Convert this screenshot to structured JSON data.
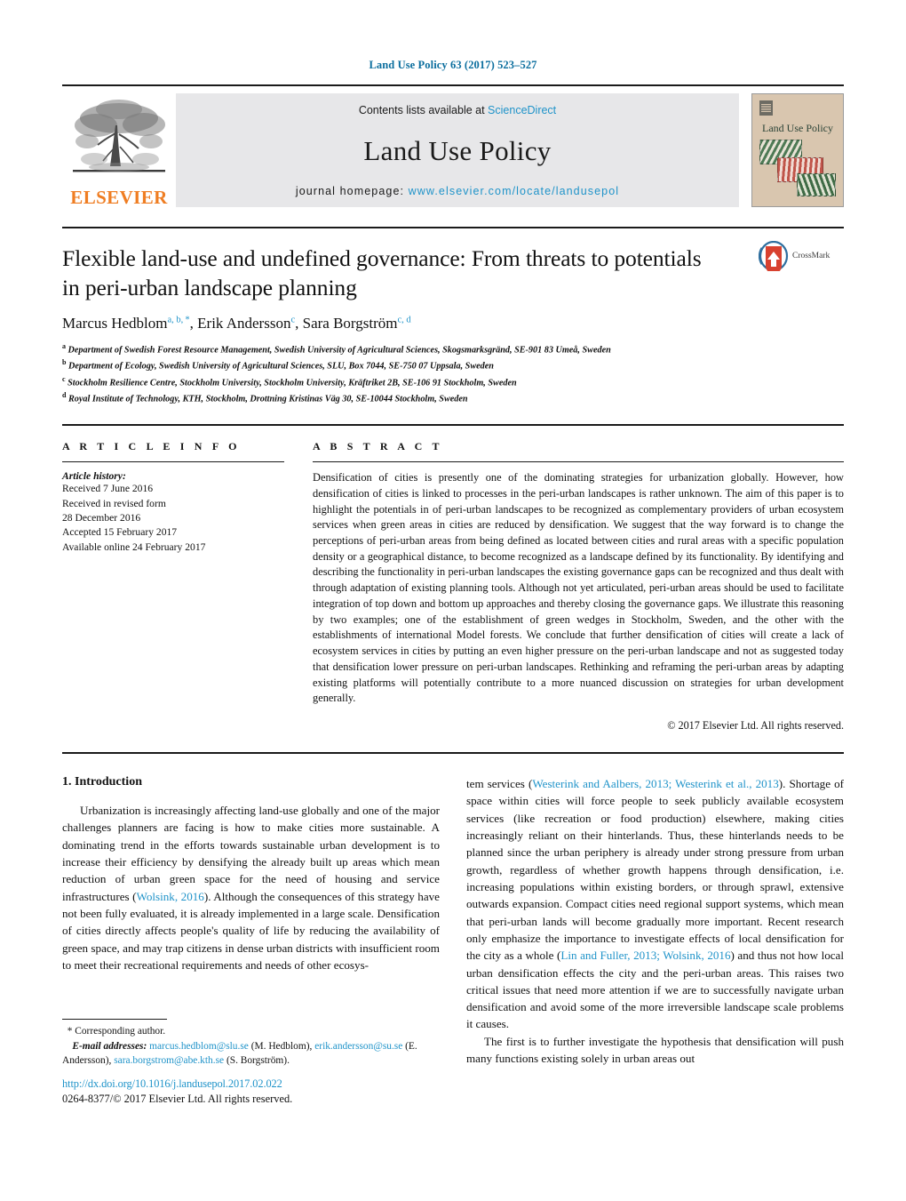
{
  "running_head": "Land Use Policy 63 (2017) 523–527",
  "masthead": {
    "publisher_name": "ELSEVIER",
    "contents_prefix": "Contents lists available at ",
    "contents_link": "ScienceDirect",
    "journal_name": "Land Use Policy",
    "homepage_prefix": "journal homepage: ",
    "homepage_url": "www.elsevier.com/locate/landusepol",
    "cover_title": "Land Use Policy"
  },
  "article": {
    "title": "Flexible land-use and undefined governance: From threats to potentials in peri-urban landscape planning",
    "crossmark_label": "CrossMark",
    "authors_html": "Marcus Hedblom<sup>a, b, *</sup>, Erik Andersson<sup>c</sup>, Sara Borgström<sup>c, d</sup>",
    "affiliations": [
      {
        "marker": "a",
        "text": "Department of Swedish Forest Resource Management, Swedish University of Agricultural Sciences, Skogsmarksgränd, SE-901 83 Umeå, Sweden"
      },
      {
        "marker": "b",
        "text": "Department of Ecology, Swedish University of Agricultural Sciences, SLU, Box 7044, SE-750 07 Uppsala, Sweden"
      },
      {
        "marker": "c",
        "text": "Stockholm Resilience Centre, Stockholm University, Stockholm University, Kräftriket 2B, SE-106 91 Stockholm, Sweden"
      },
      {
        "marker": "d",
        "text": "Royal Institute of Technology, KTH, Stockholm, Drottning Kristinas Väg 30, SE-10044 Stockholm, Sweden"
      }
    ]
  },
  "article_info": {
    "heading": "A R T I C L E   I N F O",
    "history_label": "Article history:",
    "history_lines": [
      "Received 7 June 2016",
      "Received in revised form",
      "28 December 2016",
      "Accepted 15 February 2017",
      "Available online 24 February 2017"
    ]
  },
  "abstract": {
    "heading": "A B S T R A C T",
    "text": "Densification of cities is presently one of the dominating strategies for urbanization globally. However, how densification of cities is linked to processes in the peri-urban landscapes is rather unknown. The aim of this paper is to highlight the potentials in of peri-urban landscapes to be recognized as complementary providers of urban ecosystem services when green areas in cities are reduced by densification. We suggest that the way forward is to change the perceptions of peri-urban areas from being defined as located between cities and rural areas with a specific population density or a geographical distance, to become recognized as a landscape defined by its functionality. By identifying and describing the functionality in peri-urban landscapes the existing governance gaps can be recognized and thus dealt with through adaptation of existing planning tools. Although not yet articulated, peri-urban areas should be used to facilitate integration of top down and bottom up approaches and thereby closing the governance gaps. We illustrate this reasoning by two examples; one of the establishment of green wedges in Stockholm, Sweden, and the other with the establishments of international Model forests. We conclude that further densification of cities will create a lack of ecosystem services in cities by putting an even higher pressure on the peri-urban landscape and not as suggested today that densification lower pressure on peri-urban landscapes. Rethinking and reframing the peri-urban areas by adapting existing platforms will potentially contribute to a more nuanced discussion on strategies for urban development generally.",
    "copyright": "© 2017 Elsevier Ltd. All rights reserved."
  },
  "body": {
    "section_heading": "1.  Introduction",
    "left_paragraph_1_a": "Urbanization is increasingly affecting land-use globally and one of the major challenges planners are facing is how to make cities more sustainable. A dominating trend in the efforts towards sustainable urban development is to increase their efficiency by densifying the already built up areas which mean reduction of urban green space for the need of housing and service infrastructures (",
    "cite_wolsink_2016": "Wolsink, 2016",
    "left_paragraph_1_b": "). Although the consequences of this strategy have not been fully evaluated, it is already implemented in a large scale. Densification of cities directly affects people's quality of life by reducing the availability of green space, and may trap citizens in dense urban districts with insufficient room to meet their recreational requirements and needs of other ecosys-",
    "right_paragraph_1_a": "tem services (",
    "cite_westerink": "Westerink and Aalbers, 2013; Westerink et al., 2013",
    "right_paragraph_1_b": "). Shortage of space within cities will force people to seek publicly available ecosystem services (like recreation or food production) elsewhere, making cities increasingly reliant on their hinterlands. Thus, these hinterlands needs to be planned since the urban periphery is already under strong pressure from urban growth, regardless of whether growth happens through densification, i.e. increasing populations within existing borders, or through sprawl, extensive outwards expansion. Compact cities need regional support systems, which mean that peri-urban lands will become gradually more important. Recent research only emphasize the importance to investigate effects of local densification for the city as a whole (",
    "cite_lin_fuller": "Lin and Fuller, 2013; Wolsink, 2016",
    "right_paragraph_1_c": ") and thus not how local urban densification effects the city and the peri-urban areas. This raises two critical issues that need more attention if we are to successfully navigate urban densification and avoid some of the more irreversible landscape scale problems it causes.",
    "right_paragraph_2": "The first is to further investigate the hypothesis that densification will push many functions existing solely in urban areas out"
  },
  "footnote": {
    "corresponding_marker": "*",
    "corresponding_text": "Corresponding author.",
    "email_label": "E-mail addresses:",
    "email_1": "marcus.hedblom@slu.se",
    "email_1_name": "(M. Hedblom),",
    "email_2": "erik.andersson@su.se",
    "email_2_name": "(E. Andersson),",
    "email_3": "sara.borgstrom@abe.kth.se",
    "email_3_name": "(S. Borgström)."
  },
  "doi": {
    "url": "http://dx.doi.org/10.1016/j.landusepol.2017.02.022",
    "issn_line": "0264-8377/© 2017 Elsevier Ltd. All rights reserved."
  },
  "colors": {
    "link_blue": "#1f93c9",
    "running_head_blue": "#0b6e9e",
    "elsevier_orange": "#ef7d22",
    "band_gray": "#e7e7e9"
  }
}
